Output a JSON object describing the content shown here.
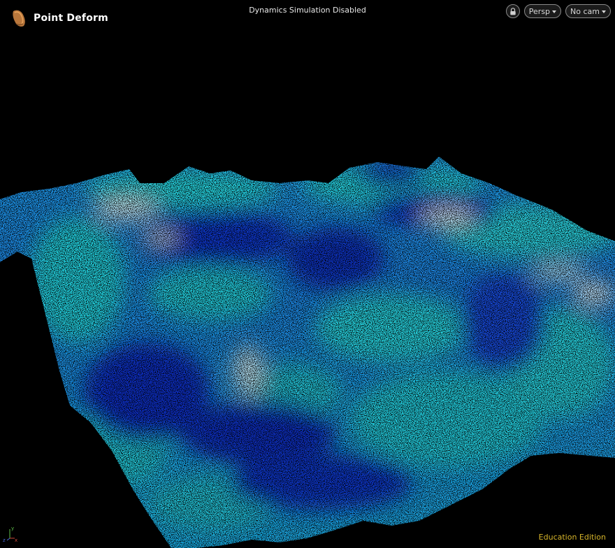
{
  "viewer": {
    "node_name": "Point Deform",
    "node_icon": "point-deform-icon",
    "status": "Dynamics Simulation Disabled",
    "edition": "Education Edition"
  },
  "controls": {
    "lock_icon": "lock-icon",
    "view_label": "Persp",
    "camera_label": "No cam"
  },
  "axes": {
    "x": "x",
    "y": "y",
    "z": "z"
  },
  "colors": {
    "background": "#000000",
    "deep_blue": "#0a28c8",
    "mid_blue": "#1a6ee8",
    "cyan": "#1fd0dc",
    "pale": "#d6e6ee",
    "edition_text": "#d7b52a"
  }
}
